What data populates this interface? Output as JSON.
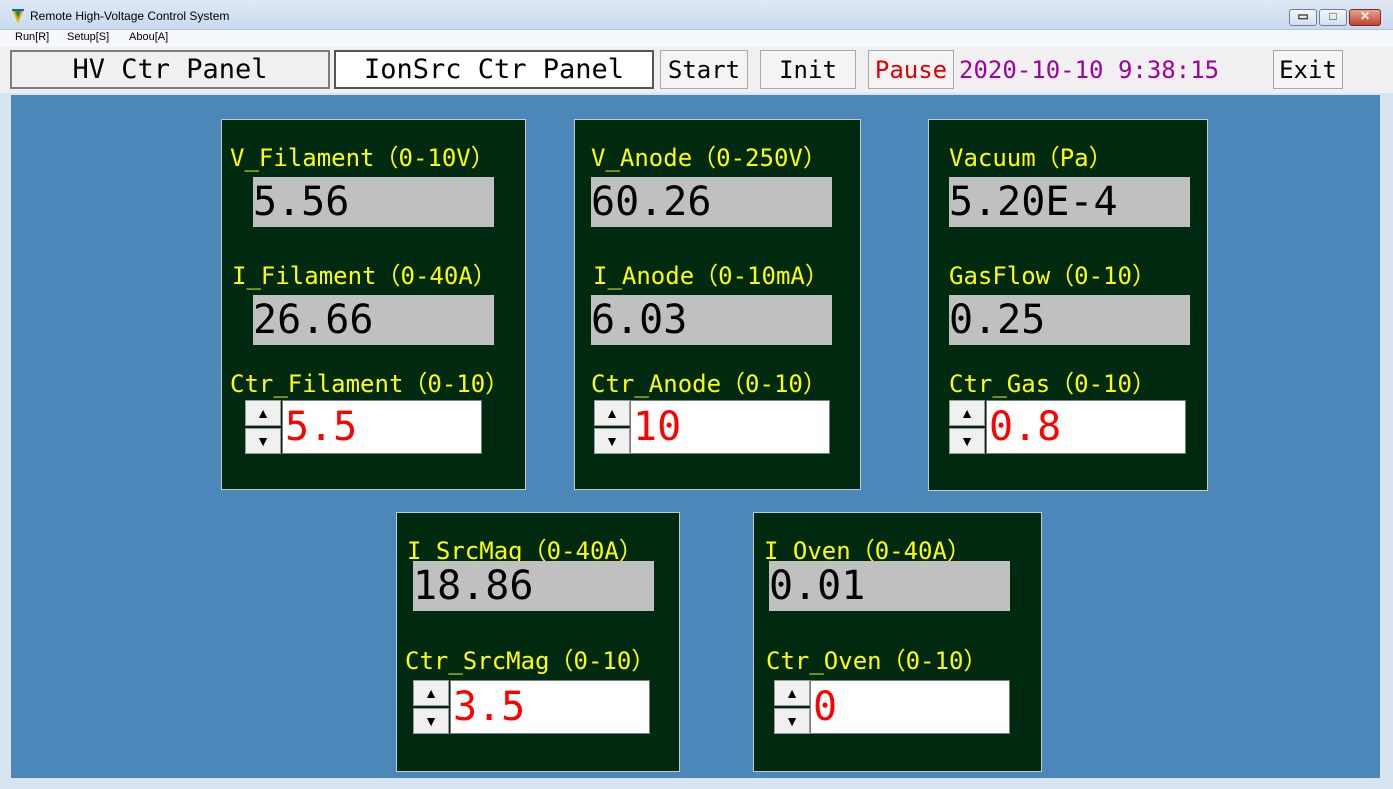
{
  "window": {
    "title": "Remote High-Voltage Control System",
    "controls": {
      "minimize": "▭",
      "maximize": "□",
      "close": "✕"
    }
  },
  "menu": {
    "run": "Run[R]",
    "setup": "Setup[S]",
    "about": "Abou[A]"
  },
  "toolbar": {
    "hv_tab": "HV Ctr Panel",
    "ionsrc_tab": "IonSrc Ctr Panel",
    "start": "Start",
    "init": "Init",
    "pause": "Pause",
    "datetime": "2020-10-10 9:38:15",
    "exit": "Exit"
  },
  "panels": {
    "filament": {
      "v_label": "V_Filament（0-10V）",
      "v_value": "5.56",
      "i_label": "I_Filament（0-40A）",
      "i_value": "26.66",
      "ctr_label": "Ctr_Filament（0-10）",
      "ctr_value": "5.5"
    },
    "anode": {
      "v_label": "V_Anode（0-250V）",
      "v_value": "60.26",
      "i_label": "I_Anode（0-10mA）",
      "i_value": "6.03",
      "ctr_label": "Ctr_Anode（0-10）",
      "ctr_value": "10"
    },
    "gas": {
      "vac_label": "Vacuum（Pa）",
      "vac_value": "5.20E-4",
      "flow_label": "GasFlow（0-10）",
      "flow_value": "0.25",
      "ctr_label": "Ctr_Gas（0-10）",
      "ctr_value": "0.8"
    },
    "srcmag": {
      "i_label": "I_SrcMag（0-40A）",
      "i_value": "18.86",
      "ctr_label": "Ctr_SrcMag（0-10）",
      "ctr_value": "3.5"
    },
    "oven": {
      "i_label": "I_Oven（0-40A）",
      "i_value": "0.01",
      "ctr_label": "Ctr_Oven（0-10）",
      "ctr_value": "0"
    }
  },
  "spinner": {
    "up": "▲",
    "down": "▼"
  },
  "colors": {
    "panel_bg": "#002a10",
    "label": "#ffff00",
    "setpoint": "#ff0000",
    "workspace": "#4b88b9",
    "clock": "#a000a0"
  }
}
